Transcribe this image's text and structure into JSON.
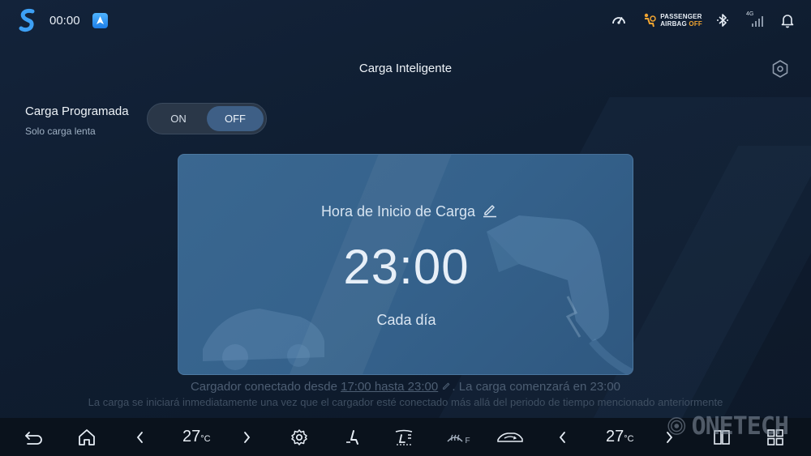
{
  "status_bar": {
    "time": "00:00",
    "airbag_line1": "PASSENGER",
    "airbag_line2": "AIRBAG",
    "airbag_state": "OFF",
    "signal_label": "4G",
    "icons": [
      "app-logo-icon",
      "android-auto-icon",
      "tachometer-icon",
      "airbag-icon",
      "bluetooth-icon",
      "signal-icon",
      "bell-icon"
    ]
  },
  "header": {
    "title": "Carga Inteligente"
  },
  "scheduled": {
    "title": "Carga Programada",
    "subtitle": "Solo carga lenta",
    "toggle_on": "ON",
    "toggle_off": "OFF",
    "selected": "OFF"
  },
  "card": {
    "label": "Hora de Inicio de Carga",
    "time": "23:00",
    "repeat": "Cada día"
  },
  "info": {
    "line1_prefix": "Cargador conectado desde",
    "line1_link": "17:00 hasta 23:00",
    "line1_suffix": ". La carga comenzará en 23:00",
    "line2": "La carga se iniciará inmediatamente una vez que el cargador esté conectado más allá del periodo de tiempo mencionado anteriormente"
  },
  "bottom_bar": {
    "temp_left": "27",
    "temp_right": "27",
    "temp_unit": "°C",
    "fan_label": "F"
  },
  "watermark": {
    "text": "ONETECH"
  },
  "colors": {
    "background": "#0f1b2b",
    "card": "#3a6790",
    "toggle_active": "#3e5f86",
    "airbag_off": "#f2a531"
  }
}
